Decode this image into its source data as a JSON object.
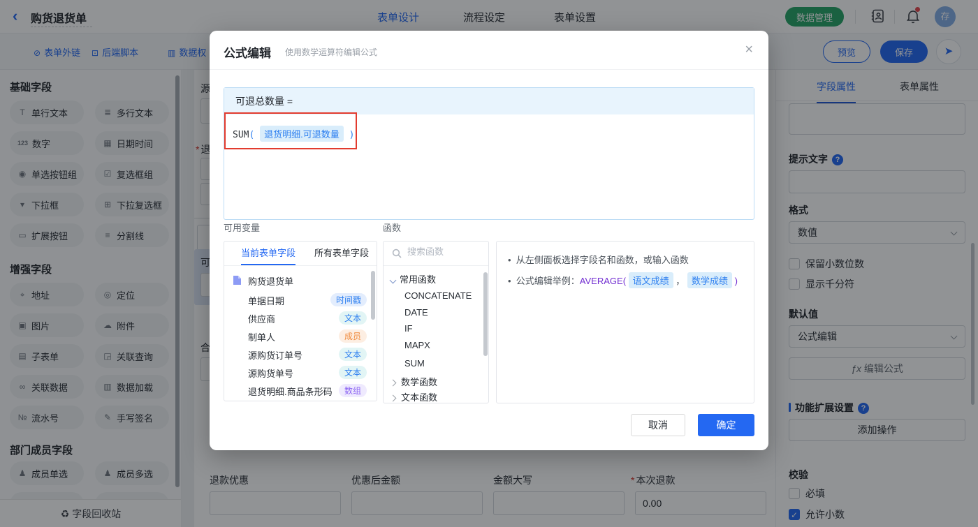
{
  "colors": {
    "primary": "#2468f2",
    "green": "#27a567",
    "annotation_red": "#e23b2e"
  },
  "topbar": {
    "back_icon": "‹",
    "title": "购货退货单",
    "tabs": [
      {
        "label": "表单设计"
      },
      {
        "label": "流程设定"
      },
      {
        "label": "表单设置"
      }
    ],
    "data_manage": "数据管理",
    "avatar": "存"
  },
  "toolbar": {
    "links": [
      {
        "icon": "⊘",
        "label": "表单外链"
      },
      {
        "icon": "⊡",
        "label": "后端脚本"
      },
      {
        "icon": "▥",
        "label": "数据权"
      }
    ],
    "preview": "预览",
    "save": "保存",
    "share_icon": "➤"
  },
  "sidebar": {
    "sections": [
      {
        "title": "基础字段",
        "items": [
          {
            "icon": "T",
            "label": "单行文本"
          },
          {
            "icon": "≣",
            "label": "多行文本"
          },
          {
            "icon": "123",
            "label": "数字"
          },
          {
            "icon": "▦",
            "label": "日期时间"
          },
          {
            "icon": "◉",
            "label": "单选按钮组"
          },
          {
            "icon": "☑",
            "label": "复选框组"
          },
          {
            "icon": "▾",
            "label": "下拉框"
          },
          {
            "icon": "⊞",
            "label": "下拉复选框"
          },
          {
            "icon": "▭",
            "label": "扩展按钮"
          },
          {
            "icon": "≡",
            "label": "分割线"
          }
        ]
      },
      {
        "title": "增强字段",
        "items": [
          {
            "icon": "⌖",
            "label": "地址"
          },
          {
            "icon": "◎",
            "label": "定位"
          },
          {
            "icon": "▣",
            "label": "图片"
          },
          {
            "icon": "☁",
            "label": "附件"
          },
          {
            "icon": "▤",
            "label": "子表单"
          },
          {
            "icon": "◲",
            "label": "关联查询"
          },
          {
            "icon": "∞",
            "label": "关联数据"
          },
          {
            "icon": "▥",
            "label": "数据加载"
          },
          {
            "icon": "№",
            "label": "流水号"
          },
          {
            "icon": "✎",
            "label": "手写签名"
          }
        ]
      },
      {
        "title": "部门成员字段",
        "items": [
          {
            "icon": "♟",
            "label": "成员单选"
          },
          {
            "icon": "♟",
            "label": "成员多选"
          }
        ]
      }
    ],
    "recycle_icon": "♻",
    "recycle": "字段回收站"
  },
  "canvas": {
    "partial_labels": {
      "a": "源",
      "b_req": "*",
      "b": "退",
      "c": "可",
      "d": "合"
    },
    "bottom_fields": [
      {
        "label": "退款优惠",
        "value": ""
      },
      {
        "label": "优惠后金额",
        "value": ""
      },
      {
        "label": "金额大写",
        "value": ""
      },
      {
        "label": "本次退款",
        "required": "*",
        "value": "0.00"
      }
    ]
  },
  "modal": {
    "title": "公式编辑",
    "subtitle": "使用数学运算符编辑公式",
    "close_icon": "×",
    "formula_target": "可退总数量 =",
    "formula": {
      "fn": "SUM",
      "open": "(",
      "chip": "退货明细.可退数量",
      "close": ")"
    },
    "variables": {
      "label": "可用变量",
      "tabs": [
        {
          "label": "当前表单字段"
        },
        {
          "label": "所有表单字段"
        }
      ],
      "root": "购货退货单",
      "fields": [
        {
          "name": "单据日期",
          "badge": "时间戳"
        },
        {
          "name": "供应商",
          "badge": "文本"
        },
        {
          "name": "制单人",
          "badge": "成员"
        },
        {
          "name": "源购货订单号",
          "badge": "文本"
        },
        {
          "name": "源购货单号",
          "badge": "文本"
        },
        {
          "name": "退货明细.商品条形码",
          "badge": "数组"
        }
      ]
    },
    "functions": {
      "label": "函数",
      "search_placeholder": "搜索函数",
      "group_common": "常用函数",
      "common_items": [
        "CONCATENATE",
        "DATE",
        "IF",
        "MAPX",
        "SUM"
      ],
      "group_math": "数学函数",
      "group_text": "文本函数"
    },
    "help": {
      "bullet1": "从左侧面板选择字段名和函数，或输入函数",
      "bullet2_prefix": "公式编辑举例：",
      "fn": "AVERAGE",
      "open": "(",
      "chip1": "语文成绩",
      "comma": "，",
      "chip2": "数学成绩",
      "close": ")"
    },
    "cancel": "取消",
    "ok": "确定"
  },
  "rpanel": {
    "tabs": [
      {
        "label": "字段属性"
      },
      {
        "label": "表单属性"
      }
    ],
    "hint_label": "提示文字",
    "format_label": "格式",
    "format_value": "数值",
    "opt_decimal": "保留小数位数",
    "opt_thousand": "显示千分符",
    "default_label": "默认值",
    "default_value": "公式编辑",
    "fx": "ƒx",
    "edit_formula": "编辑公式",
    "ext_label": "功能扩展设置",
    "add_action": "添加操作",
    "validate_label": "校验",
    "required_label": "必填",
    "allow_decimal_label": "允许小数",
    "check_mark": "✓"
  }
}
